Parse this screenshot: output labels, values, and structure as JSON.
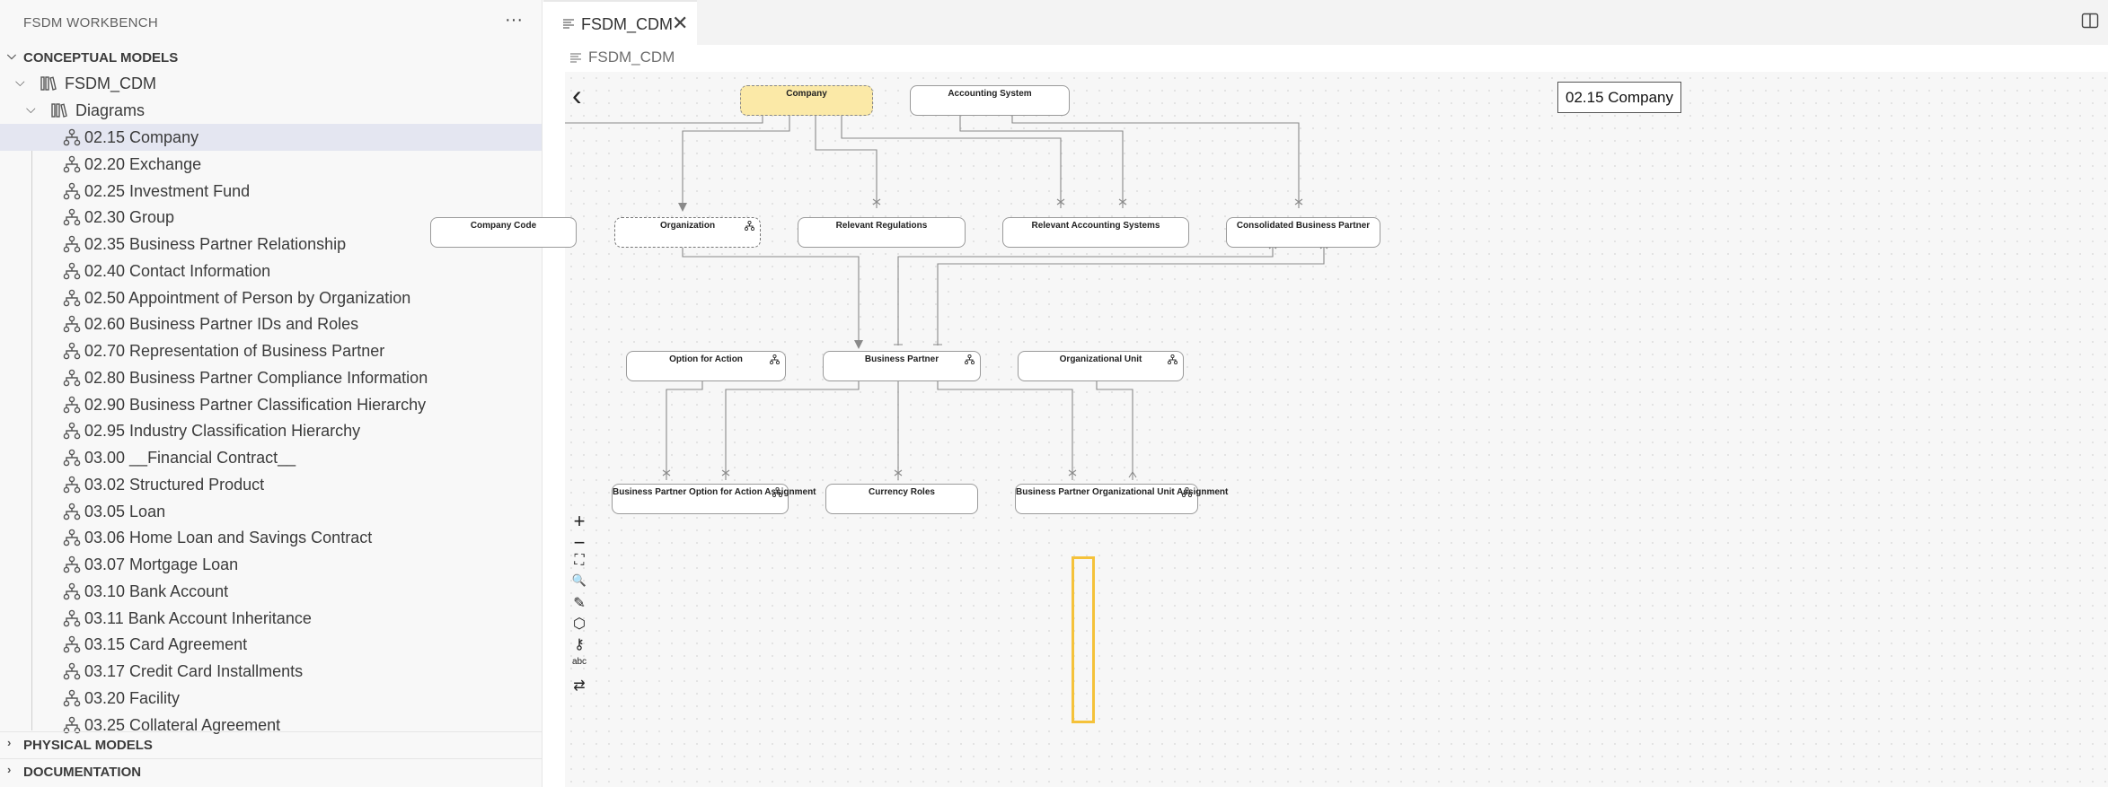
{
  "sidebar": {
    "title": "FSDM WORKBENCH",
    "more_glyph": "···",
    "conceptual_models": "CONCEPTUAL MODELS",
    "physical_models": "PHYSICAL MODELS",
    "documentation": "DOCUMENTATION",
    "model_name": "FSDM_CDM",
    "diagrams_folder": "Diagrams",
    "diagrams": [
      "02.15 Company",
      "02.20 Exchange",
      "02.25 Investment Fund",
      "02.30 Group",
      "02.35 Business Partner Relationship",
      "02.40 Contact Information",
      "02.50 Appointment of Person by Organization",
      "02.60 Business Partner IDs and Roles",
      "02.70 Representation of Business Partner",
      "02.80 Business Partner Compliance Information",
      "02.90 Business Partner Classification Hierarchy",
      "02.95 Industry Classification Hierarchy",
      "03.00 __Financial Contract__",
      "03.02 Structured Product",
      "03.05 Loan",
      "03.06 Home Loan and Savings Contract",
      "03.07 Mortgage Loan",
      "03.10 Bank Account",
      "03.11 Bank Account Inheritance",
      "03.15 Card Agreement",
      "03.17 Credit Card Installments",
      "03.20 Facility",
      "03.25 Collateral Agreement"
    ],
    "selected_diagram": "02.15 Company"
  },
  "editor": {
    "tab_label": "FSDM_CDM",
    "breadcrumb": "FSDM_CDM",
    "diagram_title": "02.15 Company",
    "back_glyph": "‹"
  },
  "entities": {
    "company": "Company",
    "accounting_system": "Accounting System",
    "company_code": "Company Code",
    "organization": "Organization",
    "relevant_regulations": "Relevant Regulations",
    "relevant_accounting_systems": "Relevant Accounting Systems",
    "consolidated_business_partner": "Consolidated Business Partner",
    "option_for_action": "Option for Action",
    "business_partner": "Business Partner",
    "organizational_unit": "Organizational Unit",
    "bp_option_for_action_assignment": "Business Partner Option for Action Assignment",
    "currency_roles": "Currency Roles",
    "bp_org_unit_assignment": "Business Partner Organizational Unit Assignment"
  },
  "toolbar": {
    "zoom_in": "+",
    "zoom_out": "−",
    "fit": "⛶",
    "search": "🔍",
    "edit": "✎",
    "entity": "⬡",
    "key": "⚷",
    "abc": "abc",
    "swap": "⇄"
  },
  "colors": {
    "highlight_entity": "#fbe9a7",
    "selection": "#f5c23a",
    "selected_row": "#e4e6f1"
  }
}
